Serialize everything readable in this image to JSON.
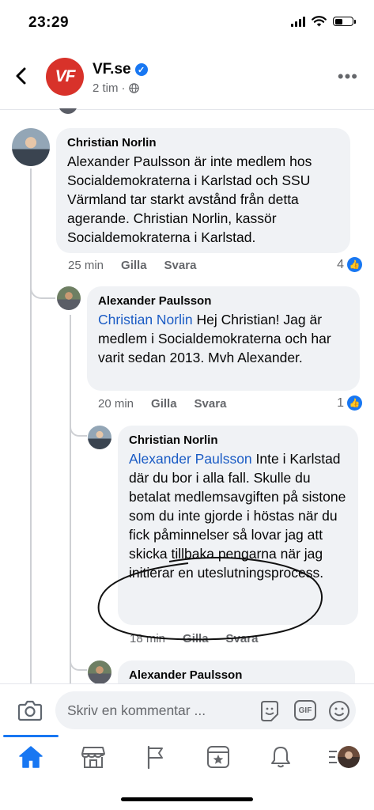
{
  "status_bar": {
    "time": "23:29"
  },
  "header": {
    "page_name": "VF.se",
    "logo_text": "VF",
    "time_ago": "2 tim",
    "icons": [
      "back-arrow-icon",
      "verified-badge-icon",
      "globe-icon",
      "more-options-icon"
    ]
  },
  "comments": [
    {
      "author": "Christian Norlin",
      "text": "Alexander Paulsson är inte medlem hos Socialdemokraterna i Karlstad och SSU Värmland tar starkt avstånd från detta agerande. Christian Norlin, kassör Socialdemokraterna i Karlstad.",
      "time": "25 min",
      "like_label": "Gilla",
      "reply_label": "Svara",
      "reaction_count": "4"
    },
    {
      "author": "Alexander Paulsson",
      "mention": "Christian Norlin",
      "text": "Hej Christian! Jag är medlem i Socialdemokraterna och har varit sedan 2013. Mvh Alexander.",
      "time": "20 min",
      "like_label": "Gilla",
      "reply_label": "Svara",
      "reaction_count": "1"
    },
    {
      "author": "Christian Norlin",
      "mention": "Alexander Paulsson",
      "text": "Inte i Karlstad där du bor i alla fall. Skulle du betalat medlemsavgiften på sistone som du inte gjorde i höstas när du fick påminnelser så lovar jag att skicka tillbaka pengarna när jag initierar en uteslutningsprocess.",
      "time": "18 min",
      "like_label": "Gilla",
      "reply_label": "Svara"
    },
    {
      "author": "Alexander Paulsson"
    }
  ],
  "composer": {
    "placeholder": "Skriv en kommentar ...",
    "gif_label": "GIF",
    "icons": [
      "camera-icon",
      "sticker-icon",
      "gif-icon",
      "emoji-icon"
    ]
  },
  "tab_bar": {
    "active": "home",
    "items": [
      "home-icon",
      "marketplace-icon",
      "pages-flag-icon",
      "news-icon",
      "notifications-bell-icon",
      "menu-profile-icon"
    ]
  },
  "colors": {
    "accent": "#1877f2",
    "mention": "#1a5bc4",
    "bubble": "#f0f2f5",
    "muted": "#65676b",
    "logo": "#d8322a"
  }
}
